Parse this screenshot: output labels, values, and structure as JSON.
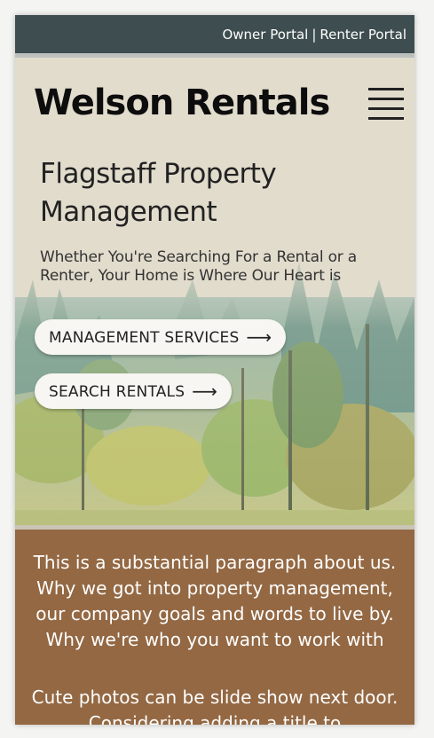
{
  "topbar": {
    "owner_portal": "Owner Portal",
    "separator": "|",
    "renter_portal": "Renter Portal"
  },
  "header": {
    "logo": "Welson Rentals",
    "menu_icon": "hamburger-menu-icon"
  },
  "hero": {
    "title": "Flagstaff Property Management",
    "subtitle": "Whether You're Searching For a Rental or a Renter, Your Home is Where Our Heart is",
    "buttons": [
      {
        "label": "MANAGEMENT SERVICES",
        "icon": "arrow-right-icon"
      },
      {
        "label": "SEARCH RENTALS",
        "icon": "arrow-right-icon"
      }
    ]
  },
  "about": {
    "paragraph": "This is a substantial paragraph about us. Why we got into property management, our company goals and words to live by. Why we're who you want to work with",
    "paragraph2": "Cute photos can be slide show next door. Considering adding a title to"
  },
  "colors": {
    "topbar": "#3e4d4f",
    "hero_bg": "#e2dccd",
    "about_bg": "#936843",
    "button_bg": "#f7f6f2"
  }
}
